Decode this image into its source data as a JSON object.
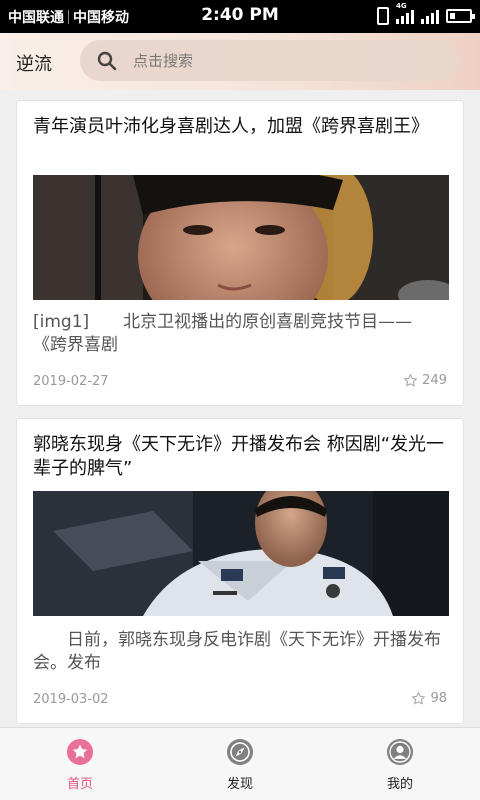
{
  "status_bar": {
    "carrier_1": "中国联通",
    "carrier_2": "中国移动",
    "time": "2:40 PM",
    "network_label": "4G",
    "battery_level": 0.3
  },
  "header": {
    "title": "逆流",
    "search_placeholder": "点击搜索",
    "search_icon": "search-icon"
  },
  "articles": [
    {
      "title": "青年演员叶沛化身喜剧达人，加盟《跨界喜剧王》",
      "snippet": "[img1]　　北京卫视播出的原创喜剧竞技节目——《跨界喜剧",
      "date": "2019-02-27",
      "likes": "249"
    },
    {
      "title": "郭晓东现身《天下无诈》开播发布会 称因剧“发光一辈子的脾气”",
      "snippet": "　　日前，郭晓东现身反电诈剧《天下无诈》开播发布会。发布",
      "date": "2019-03-02",
      "likes": "98"
    }
  ],
  "tabs": [
    {
      "label": "首页",
      "icon": "home-star-icon",
      "active": true
    },
    {
      "label": "发现",
      "icon": "compass-icon",
      "active": false
    },
    {
      "label": "我的",
      "icon": "user-icon",
      "active": false
    }
  ],
  "colors": {
    "accent": "#e0537f",
    "status_bar": "#000000",
    "header_gradient_start": "#f9efe8",
    "header_gradient_end": "#eed0c3"
  }
}
